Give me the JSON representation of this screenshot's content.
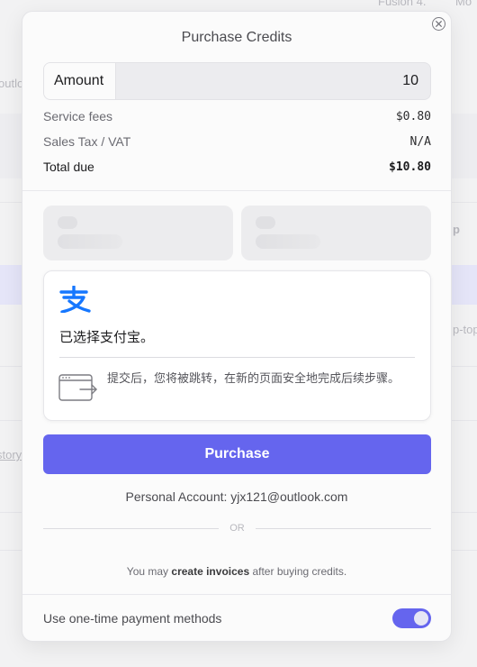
{
  "background": {
    "frag_top_1": "Fusion 4.",
    "frag_top_2": "Mo",
    "frag_outlook": "outlo",
    "frag_p": "p",
    "frag_top": "p-top",
    "frag_story": "story"
  },
  "modal": {
    "title": "Purchase Credits",
    "close_icon": "close-circle-icon"
  },
  "amount": {
    "label": "Amount",
    "value": "10"
  },
  "fees": {
    "service_label": "Service fees",
    "service_value": "$0.80",
    "tax_label": "Sales Tax / VAT",
    "tax_value": "N/A",
    "total_label": "Total due",
    "total_value": "$10.80"
  },
  "payment": {
    "selected_method_icon": "alipay-icon",
    "alipay_color": "#1677ff",
    "selected_text": "已选择支付宝。",
    "redirect_icon": "browser-redirect-icon",
    "redirect_text": "提交后，您将被跳转，在新的页面安全地完成后续步骤。"
  },
  "purchase": {
    "button_label": "Purchase",
    "accent": "#6565ee"
  },
  "account": {
    "text": "Personal Account: yjx121@outlook.com"
  },
  "separator": {
    "or": "OR"
  },
  "invoice": {
    "prefix": "You may",
    "link": "create invoices",
    "suffix": "after buying credits."
  },
  "one_time": {
    "label": "Use one-time payment methods",
    "enabled": true
  }
}
